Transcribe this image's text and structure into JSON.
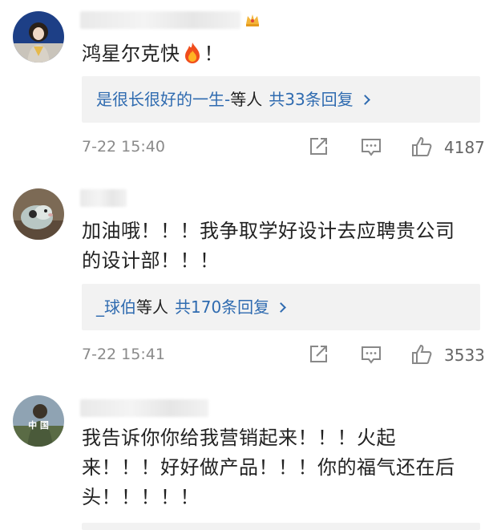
{
  "comments": [
    {
      "text": "鸿星尔克快",
      "emoji": "fire-emoji",
      "text_suffix": "！",
      "reply_names": "是很长很好的一生-",
      "reply_rest": "等人",
      "reply_count": "共33条回复",
      "time": "7-22 15:40",
      "likes": "4187"
    },
    {
      "text_line1": "加油哦！！！我争取学好设计去应聘贵公司",
      "text_line2": "的设计部！！！",
      "reply_names": "_球伯",
      "reply_rest": "等人",
      "reply_count": "共170条回复",
      "time": "7-22 15:41",
      "likes": "3533"
    },
    {
      "avatar_text": "中 国",
      "text_line1": "我告诉你你给我营销起来！！！火起",
      "text_line2": "来！！！好好做产品！！！你的福气还在后",
      "text_line3": "头！！！！！"
    }
  ],
  "icons": {
    "share": "share-icon",
    "comment": "comment-icon",
    "like": "thumbs-up-icon",
    "chevron": "chevron-right-icon",
    "badge": "crown-badge-icon"
  },
  "colors": {
    "link": "#2f6bb0",
    "reply_bg": "#f2f2f2",
    "meta_text": "#8a8a8a"
  }
}
